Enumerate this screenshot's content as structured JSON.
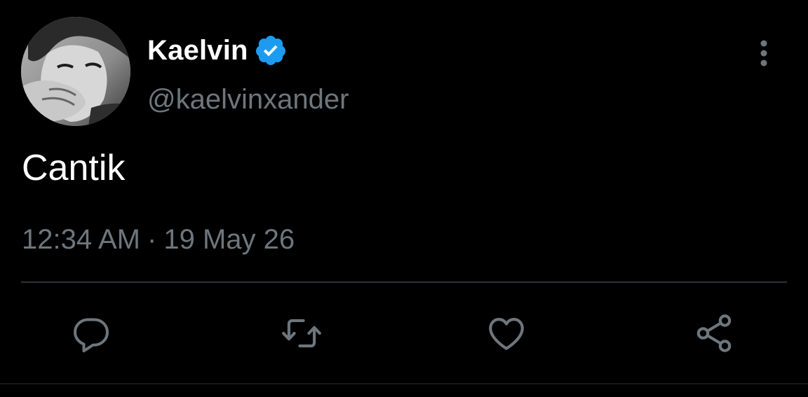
{
  "user": {
    "display_name": "Kaelvin",
    "handle": "@kaelvinxander",
    "verified": true
  },
  "tweet": {
    "text": "Cantik",
    "time": "12:34 AM",
    "separator": "·",
    "date": "19 May 26"
  },
  "actions": [
    {
      "icon": "reply-icon"
    },
    {
      "icon": "retweet-icon"
    },
    {
      "icon": "like-icon"
    },
    {
      "icon": "share-icon"
    }
  ],
  "colors": {
    "background": "#000000",
    "primary_text": "#ffffff",
    "secondary_text": "#6e767d",
    "verified_badge": "#1d9bf0",
    "divider": "#2f3336"
  }
}
